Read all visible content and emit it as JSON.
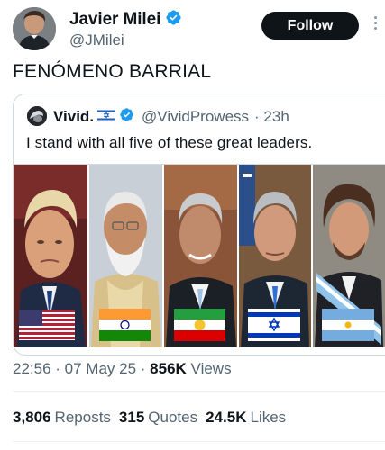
{
  "author": {
    "display_name": "Javier Milei",
    "handle": "@JMilei",
    "verified_icon": "verified-badge-icon"
  },
  "follow_label": "Follow",
  "tweet_text": "FENÓMENO BARRIAL",
  "quoted": {
    "display_name": "Vivid.",
    "handle": "@VividProwess",
    "time": "· 23h",
    "text": "I stand with all five of these great leaders.",
    "flag_icon": "israel-flag-icon"
  },
  "collage_flags": [
    "united-states-flag",
    "india-flag",
    "iran-lion-and-sun-flag",
    "israel-flag",
    "argentina-flag"
  ],
  "timestamp": "22:56 · 07 May 25 ·",
  "views_count": "856K",
  "views_label": "Views",
  "stats": {
    "reposts_count": "3,806",
    "reposts_label": "Reposts",
    "quotes_count": "315",
    "quotes_label": "Quotes",
    "likes_count": "24.5K",
    "likes_label": "Likes"
  },
  "colors": {
    "text": "#0f1419",
    "secondary": "#536471",
    "verified": "#1d9bf0",
    "border": "#cfd9de"
  }
}
